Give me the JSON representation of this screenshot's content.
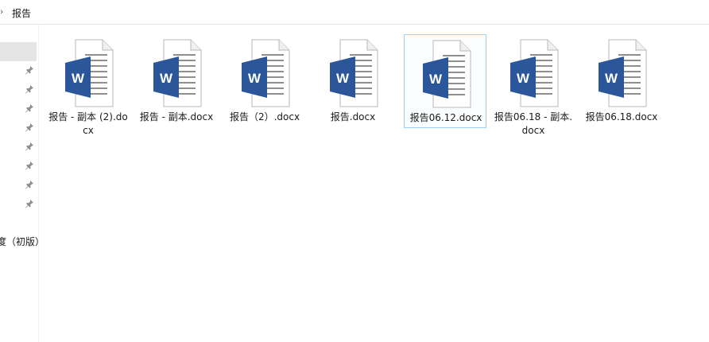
{
  "breadcrumb": {
    "chevron": "›",
    "current": "报告"
  },
  "nav": {
    "partial_label": "度（初版）"
  },
  "files": [
    {
      "name": "报告 - 副本 (2).docx",
      "icon": "word-doc-icon"
    },
    {
      "name": "报告 - 副本.docx",
      "icon": "word-doc-icon"
    },
    {
      "name": "报告（2）.docx",
      "icon": "word-doc-icon"
    },
    {
      "name": "报告.docx",
      "icon": "word-doc-icon"
    },
    {
      "name": "报告06.12.docx",
      "icon": "word-doc-icon",
      "selected": true
    },
    {
      "name": "报告06.18 - 副本.docx",
      "icon": "word-doc-icon"
    },
    {
      "name": "报告06.18.docx",
      "icon": "word-doc-icon"
    }
  ],
  "colors": {
    "word_blue": "#2b579a",
    "selection_border": "#99d1ff"
  }
}
